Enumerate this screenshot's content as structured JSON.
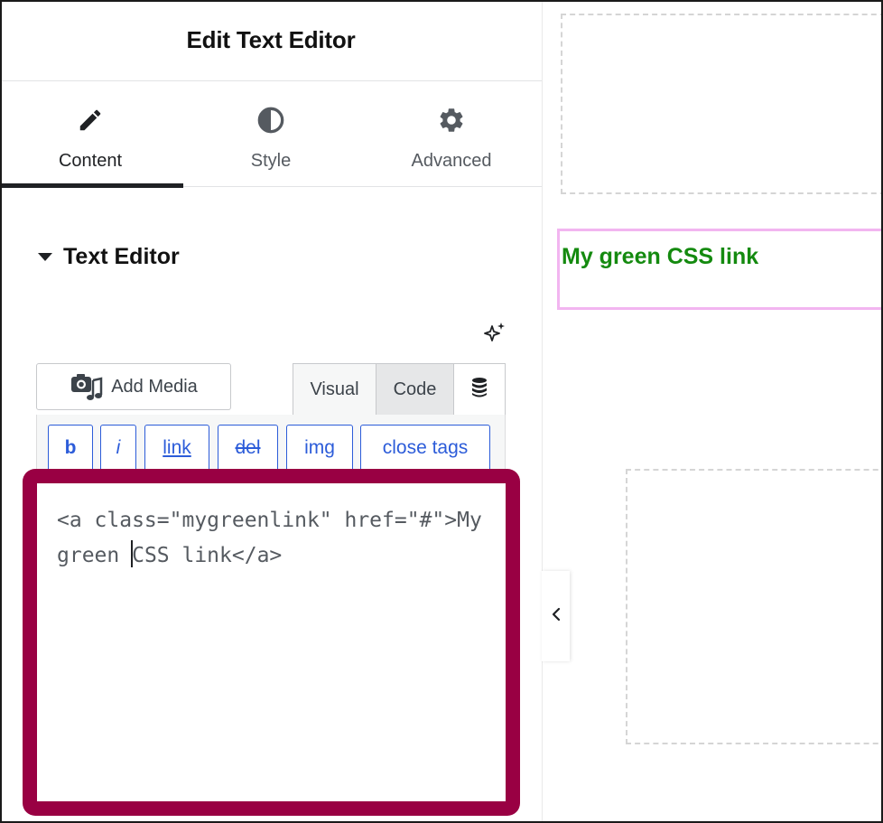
{
  "panel": {
    "title": "Edit Text Editor",
    "tabs": [
      {
        "label": "Content",
        "icon": "pencil-icon",
        "active": true
      },
      {
        "label": "Style",
        "icon": "half-circle-icon",
        "active": false
      },
      {
        "label": "Advanced",
        "icon": "gear-icon",
        "active": false
      }
    ],
    "section_title": "Text Editor",
    "ai_icon": "sparkle-icon"
  },
  "toolbar": {
    "add_media_label": "Add Media",
    "visual_label": "Visual",
    "code_label": "Code",
    "active_mode": "Code",
    "quicktags": [
      "b",
      "i",
      "link",
      "del",
      "img",
      "close tags"
    ]
  },
  "code_editor": {
    "before_cursor": "<a class=\"mygreenlink\" href=\"#\">My green ",
    "after_cursor": "CSS link</a>"
  },
  "canvas": {
    "link_text": "My green CSS link",
    "link_color": "#148a0f",
    "selected_border_color": "#f2b5f0"
  },
  "colors": {
    "highlight_frame": "#990043",
    "quicktag_blue": "#2c5cd9"
  }
}
